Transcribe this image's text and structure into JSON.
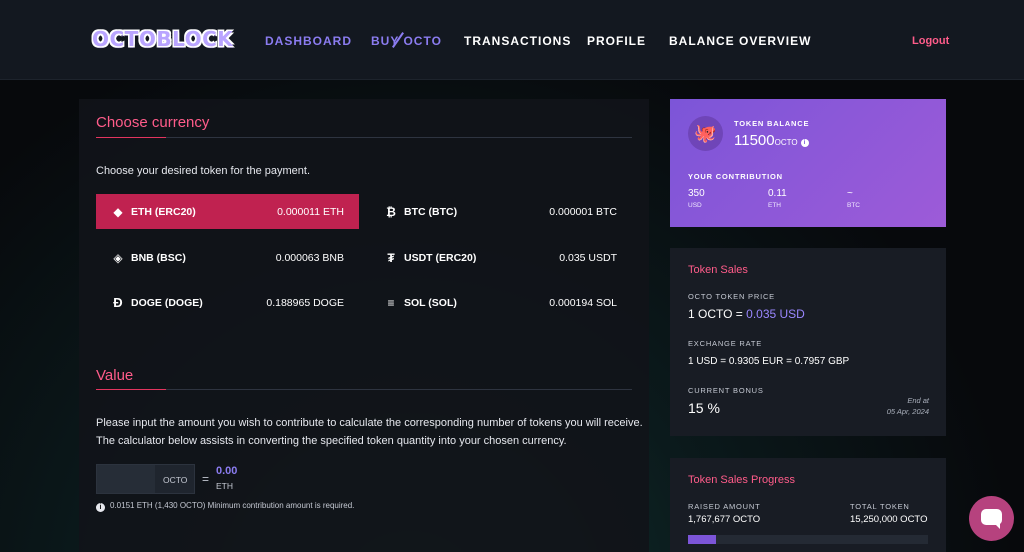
{
  "header": {
    "logo": "OCTOBLOCK",
    "nav": [
      "DASHBOARD",
      "BUY OCTO",
      "TRANSACTIONS",
      "PROFILE",
      "BALANCE OVERVIEW"
    ],
    "logout": "Logout"
  },
  "currency": {
    "title": "Choose currency",
    "hint": "Choose your desired token for the payment.",
    "options": [
      {
        "name": "ETH (ERC20)",
        "rate": "0.000011 ETH",
        "icon": "ethereum-icon",
        "selected": true
      },
      {
        "name": "BTC (BTC)",
        "rate": "0.000001 BTC",
        "icon": "bitcoin-icon",
        "selected": false
      },
      {
        "name": "BNB (BSC)",
        "rate": "0.000063 BNB",
        "icon": "bnb-icon",
        "selected": false
      },
      {
        "name": "USDT (ERC20)",
        "rate": "0.035 USDT",
        "icon": "tether-icon",
        "selected": false
      },
      {
        "name": "DOGE (DOGE)",
        "rate": "0.188965 DOGE",
        "icon": "dogecoin-icon",
        "selected": false
      },
      {
        "name": "SOL (SOL)",
        "rate": "0.000194 SOL",
        "icon": "solana-icon",
        "selected": false
      }
    ]
  },
  "value": {
    "title": "Value",
    "line1": "Please input the amount you wish to contribute to calculate the corresponding number of tokens you will receive.",
    "line2": "The calculator below assists in converting the specified token quantity into your chosen currency.",
    "input_value": "",
    "input_unit": "OCTO",
    "equals": "=",
    "result": "0.00",
    "result_unit": "ETH",
    "note": "0.0151 ETH (1,430 OCTO) Minimum contribution amount is required."
  },
  "balance": {
    "label": "TOKEN BALANCE",
    "amount": "11500",
    "unit": "OCTO",
    "contribution_label": "YOUR CONTRIBUTION",
    "contributions": [
      {
        "value": "350",
        "unit": "USD"
      },
      {
        "value": "0.11",
        "unit": "ETH"
      },
      {
        "value": "~",
        "unit": "BTC"
      }
    ]
  },
  "sales": {
    "title": "Token Sales",
    "price_label": "OCTO TOKEN PRICE",
    "price_prefix": "1 OCTO = ",
    "price_value": "0.035 USD",
    "exchange_label": "EXCHANGE RATE",
    "exchange_value": "1 USD = 0.9305 EUR = 0.7957 GBP",
    "bonus_label": "CURRENT BONUS",
    "bonus_value": "15 %",
    "end_label": "End at",
    "end_date": "05 Apr, 2024"
  },
  "progress": {
    "title": "Token Sales Progress",
    "raised_label": "RAISED AMOUNT",
    "raised_value": "1,767,677 OCTO",
    "total_label": "TOTAL TOKEN",
    "total_value": "15,250,000 OCTO",
    "fraction": 0.116
  },
  "colors": {
    "accent": "#ff5c8a",
    "selected": "#c02250",
    "purple": "#7c55d8"
  }
}
